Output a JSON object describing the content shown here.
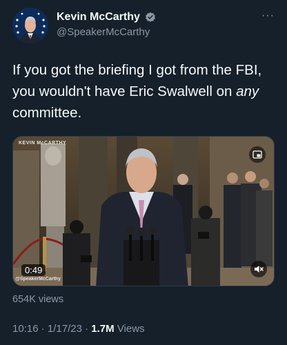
{
  "author": {
    "name": "Kevin McCarthy",
    "handle": "@SpeakerMcCarthy",
    "verified": true,
    "avatar_icon": "official-portrait-avatar"
  },
  "more_icon": "more-horizontal-icon",
  "tweet": {
    "text_before": "If you got the briefing I got from the FBI, you wouldn't have Eric Swalwell on ",
    "text_emphasis": "any",
    "text_after": " committee."
  },
  "video": {
    "watermark_top": "KEVIN McCARTHY",
    "watermark_bottom": "@SpeakerMcCarthy",
    "duration": "0:49",
    "gif_icon": "picture-in-picture-icon",
    "mute_icon": "speaker-muted-icon"
  },
  "stats": {
    "video_views": "654K views"
  },
  "footer": {
    "time": "10:16",
    "separator": "·",
    "date": "1/17/23",
    "views_count": "1.7M",
    "views_label": "Views"
  },
  "colors": {
    "background": "#15202b",
    "text": "#f7f9f9",
    "secondary": "#8b98a5",
    "verified": "#1d9bf0"
  }
}
